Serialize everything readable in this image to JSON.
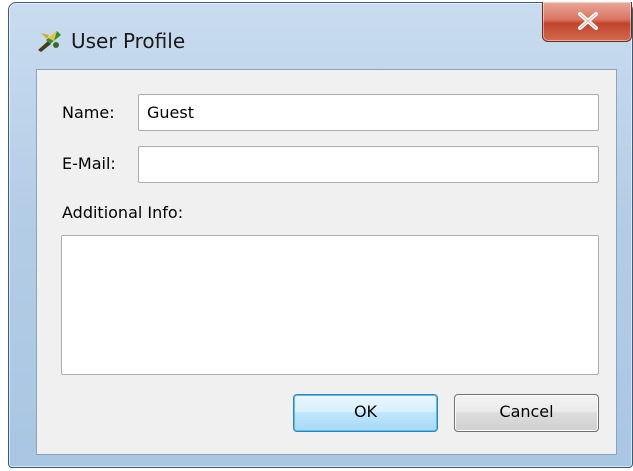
{
  "window": {
    "title": "User Profile",
    "close_symbol": "X"
  },
  "form": {
    "name_label": "Name:",
    "name_value": "Guest",
    "email_label": "E-Mail:",
    "email_value": "",
    "info_label": "Additional Info:",
    "info_value": ""
  },
  "buttons": {
    "ok_label": "OK",
    "cancel_label": "Cancel"
  },
  "icons": {
    "app": "mirror-app-icon",
    "close": "close-icon"
  },
  "colors": {
    "titlebar": "#b4cde6",
    "close_button": "#c0442c",
    "client_background": "#f0f0f0",
    "default_button_border": "#3c7fb1"
  }
}
